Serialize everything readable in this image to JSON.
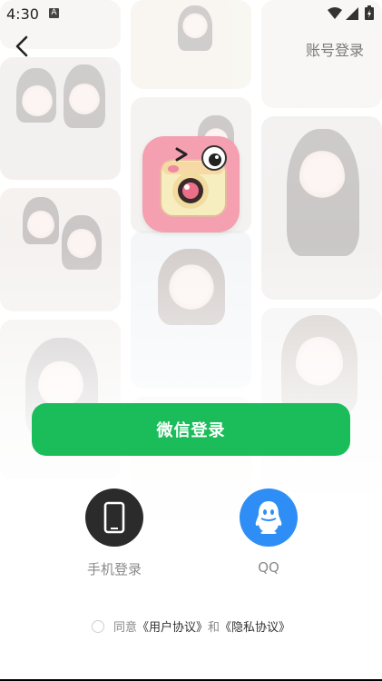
{
  "status_bar": {
    "time": "4:30",
    "notification_glyph": "A"
  },
  "header": {
    "account_login_label": "账号登录"
  },
  "primary": {
    "wechat_login_label": "微信登录"
  },
  "alternatives": {
    "phone_label": "手机登录",
    "qq_label": "QQ"
  },
  "agreement": {
    "prefix": "同意",
    "user_agreement": "《用户协议》",
    "conjunction": "和",
    "privacy_policy": "《隐私协议》"
  },
  "colors": {
    "wechat_green": "#1bbd5b",
    "qq_blue": "#2f8ef5",
    "phone_dark": "#2b2b2b",
    "logo_pink": "#f4a0b0"
  }
}
